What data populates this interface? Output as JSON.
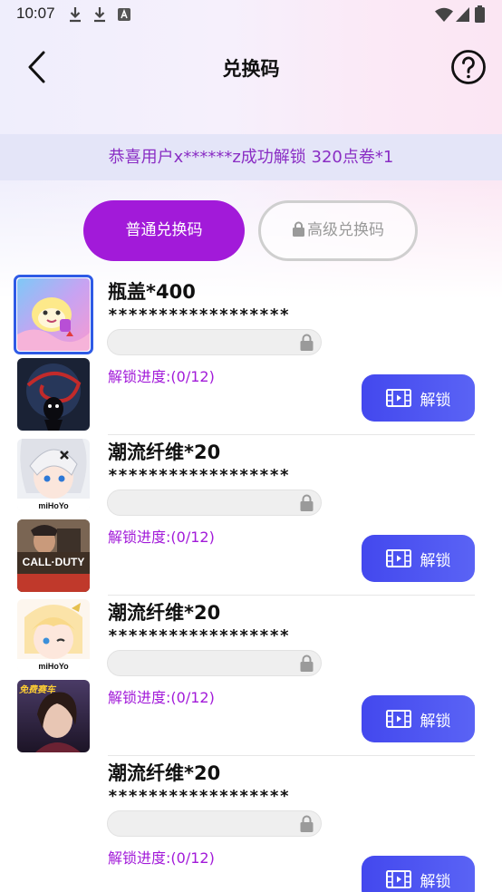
{
  "status_bar": {
    "time": "10:07",
    "icons": [
      "download-icon",
      "download-icon",
      "notification-a-icon",
      "wifi-icon",
      "signal-icon",
      "battery-icon"
    ]
  },
  "header": {
    "title": "兑换码",
    "back_icon": "back-arrow-icon",
    "help_icon": "help-circle-icon"
  },
  "banner": {
    "text": "恭喜用户x******z成功解锁 320点卷*1"
  },
  "tabs": [
    {
      "label": "普通兑换码",
      "active": true
    },
    {
      "label": "高级兑换码",
      "active": false,
      "icon": "lock-icon"
    }
  ],
  "game_icons": [
    {
      "name": "Eggy Party",
      "selected": true
    },
    {
      "name": "dark-creature-game",
      "selected": false
    },
    {
      "name": "Honkai Impact 3rd",
      "caption": "miHoYo",
      "selected": false
    },
    {
      "name": "Call of Duty Mobile",
      "caption": "CALL·DUTY",
      "selected": false
    },
    {
      "name": "Genshin Impact",
      "caption": "miHoYo",
      "selected": false
    },
    {
      "name": "racing-game",
      "caption": "免费赛车",
      "selected": false
    }
  ],
  "rewards": [
    {
      "title": "瓶盖*400",
      "code": "******************",
      "progress_text": "解锁进度:(0/12)",
      "progress": 0,
      "unlock_label": "解锁"
    },
    {
      "title": "潮流纤维*20",
      "code": "******************",
      "progress_text": "解锁进度:(0/12)",
      "progress": 0,
      "unlock_label": "解锁"
    },
    {
      "title": "潮流纤维*20",
      "code": "******************",
      "progress_text": "解锁进度:(0/12)",
      "progress": 0,
      "unlock_label": "解锁"
    },
    {
      "title": "潮流纤维*20",
      "code": "******************",
      "progress_text": "解锁进度:(0/12)",
      "progress": 0,
      "unlock_label": "解锁"
    }
  ],
  "colors": {
    "accent_purple": "#a21ad9",
    "button_blue": "#4348ee",
    "banner_bg": "#e4e5f8",
    "banner_text": "#8a2ec4"
  }
}
